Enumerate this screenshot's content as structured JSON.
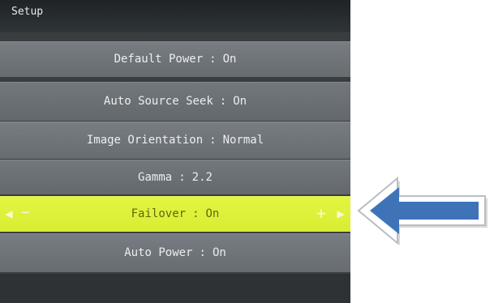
{
  "header": {
    "title": "Setup"
  },
  "menu": {
    "items": [
      {
        "label": "Default Power",
        "value": "On"
      },
      {
        "label": "Auto Source Seek",
        "value": "On"
      },
      {
        "label": "Image Orientation",
        "value": "Normal"
      },
      {
        "label": "Gamma",
        "value": "2.2"
      },
      {
        "label": "Failover",
        "value": "On"
      },
      {
        "label": "Auto Power",
        "value": "On"
      }
    ],
    "separator": ":",
    "selected_index": 4
  },
  "selected_row": {
    "left_arrow": "◀",
    "minus": "−",
    "plus": "+",
    "right_arrow": "▶"
  },
  "colors": {
    "highlight": "#dcef38",
    "callout_arrow": "#3f73b8"
  },
  "icons": [
    "arrow-left-icon",
    "minus-icon",
    "plus-icon",
    "arrow-right-icon",
    "callout-arrow-icon"
  ]
}
